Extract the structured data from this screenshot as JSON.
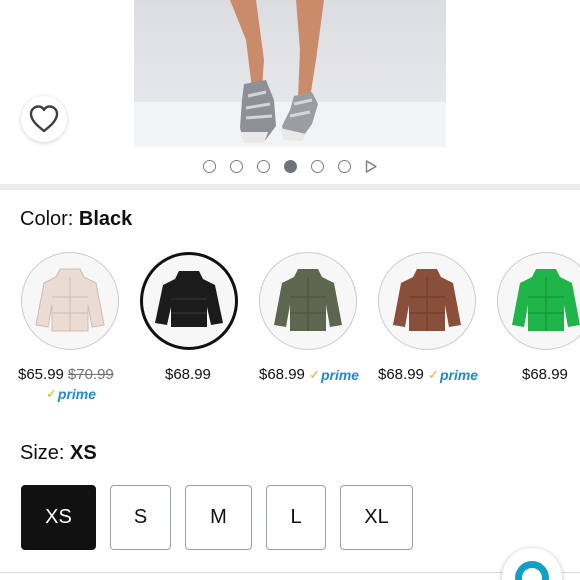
{
  "hero": {
    "favorite_icon": "heart-outline-icon",
    "pager": {
      "count": 6,
      "active_index": 3,
      "next_icon": "play-triangle-icon"
    }
  },
  "color": {
    "label": "Color: ",
    "selected_value": "Black",
    "swatches": [
      {
        "name": "cream",
        "color": "#eadcd2",
        "price": "$65.99",
        "list_price": "$70.99",
        "prime": true,
        "prime_label": "prime"
      },
      {
        "name": "black",
        "color": "#1b1b1b",
        "price": "$68.99",
        "list_price": "",
        "prime": false,
        "selected": true
      },
      {
        "name": "army-green",
        "color": "#5d6750",
        "price": "$68.99",
        "prime": true,
        "prime_label": "prime"
      },
      {
        "name": "brown",
        "color": "#8a4f3a",
        "price": "$68.99",
        "prime": true,
        "prime_label": "prime"
      },
      {
        "name": "green",
        "color": "#1fb548",
        "price": "$68.99",
        "prime": false
      }
    ]
  },
  "size": {
    "label": "Size: ",
    "selected_value": "XS",
    "options": [
      "XS",
      "S",
      "M",
      "L",
      "XL"
    ]
  }
}
